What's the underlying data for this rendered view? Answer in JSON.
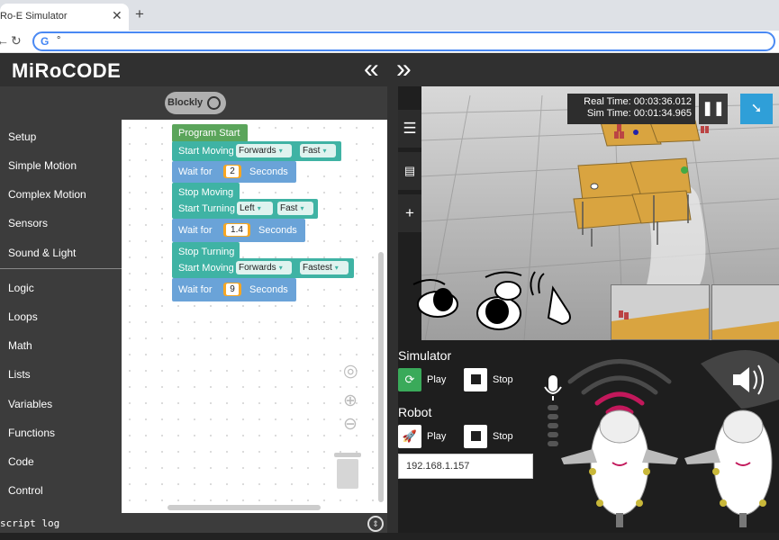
{
  "browser": {
    "tab_title": "Ro-E Simulator",
    "tab_close": "✕",
    "new_tab": "+",
    "back": "←",
    "reload": "↻",
    "address_value": "°",
    "google_icon": "G"
  },
  "header": {
    "logo": "MiRoCODE",
    "collapse_left": "«",
    "collapse_right": "»"
  },
  "editor": {
    "blockly_toggle_label": "Blockly",
    "script_log_label": "script log"
  },
  "toolbox": {
    "items": [
      {
        "label": "Setup"
      },
      {
        "label": "Simple Motion"
      },
      {
        "label": "Complex Motion"
      },
      {
        "label": "Sensors"
      },
      {
        "label": "Sound & Light"
      },
      {
        "label": "Logic"
      },
      {
        "label": "Loops"
      },
      {
        "label": "Math"
      },
      {
        "label": "Lists"
      },
      {
        "label": "Variables"
      },
      {
        "label": "Functions"
      },
      {
        "label": "Code"
      },
      {
        "label": "Control"
      }
    ]
  },
  "blocks": {
    "program_start": "Program Start",
    "start_moving_1": {
      "label": "Start Moving",
      "direction": "Forwards",
      "speed": "Fast"
    },
    "wait_1": {
      "label": "Wait for",
      "value": "2",
      "unit": "Seconds"
    },
    "stop_moving": "Stop Moving",
    "start_turning": {
      "label": "Start Turning",
      "direction": "Left",
      "speed": "Fast"
    },
    "wait_2": {
      "label": "Wait for",
      "value": "1.4",
      "unit": "Seconds"
    },
    "stop_turning": "Stop Turning",
    "start_moving_2": {
      "label": "Start Moving",
      "direction": "Forwards",
      "speed": "Fastest"
    },
    "wait_3": {
      "label": "Wait for",
      "value": "9",
      "unit": "Seconds"
    },
    "dropdown_arrow": "▾"
  },
  "simulator_view": {
    "real_time_label": "Real Time: 00:03:36.012",
    "sim_time_label": "Sim Time: 00:01:34.965",
    "sidebar_icons": [
      "menu-icon",
      "layers-icon",
      "plus-icon"
    ]
  },
  "controls": {
    "simulator_title": "Simulator",
    "sim_play": "Play",
    "sim_stop": "Stop",
    "robot_title": "Robot",
    "robot_play": "Play",
    "robot_stop": "Stop",
    "robot_ip": "192.168.1.157"
  },
  "colors": {
    "block_green": "#5ba55b",
    "block_teal": "#3fb3a4",
    "block_blue": "#6aa3d8",
    "number_orange": "#f5a623",
    "play_green": "#3aaa5a",
    "accent_blue": "#2f9fd8",
    "mic_magenta": "#c2185b"
  }
}
